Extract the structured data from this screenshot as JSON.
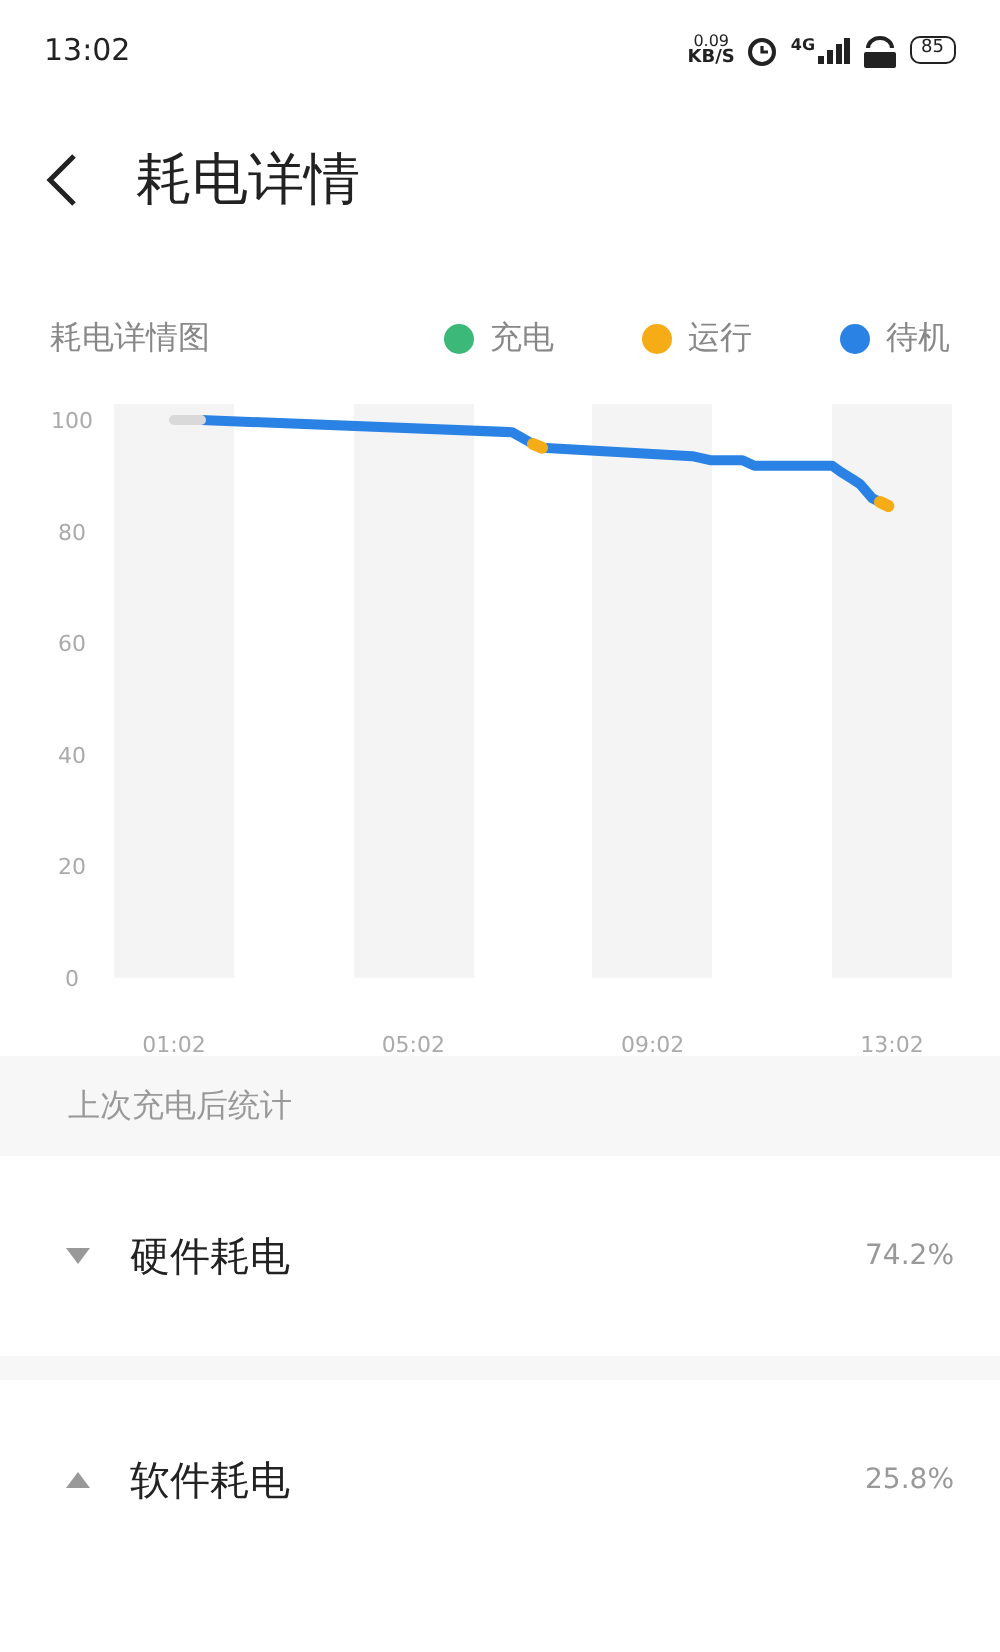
{
  "status_bar": {
    "time": "13:02",
    "net_speed": "0.09",
    "net_unit": "KB/S",
    "network": "4G",
    "battery": "85"
  },
  "header": {
    "title": "耗电详情"
  },
  "chart_section": {
    "title": "耗电详情图",
    "chart_data": {
      "type": "line",
      "x": [
        1.033,
        1.483,
        6.683,
        7.033,
        7.183,
        9.693,
        9.993,
        10.533,
        10.733,
        12.033,
        12.173,
        12.373,
        12.503,
        12.703,
        12.833,
        12.973
      ],
      "series": [
        {
          "color": "#d9d9d9",
          "values": [
            100,
            100,
            null,
            null,
            null,
            null,
            null,
            null,
            null,
            null,
            null,
            null,
            null,
            null,
            null,
            null
          ]
        },
        {
          "name": "充电",
          "color": "#3cb878",
          "values": [
            null,
            null,
            null,
            null,
            null,
            null,
            null,
            null,
            null,
            null,
            null,
            null,
            null,
            null,
            null,
            null
          ]
        },
        {
          "name": "运行",
          "color": "#f5ac16",
          "values": [
            null,
            null,
            null,
            95.7,
            95,
            null,
            null,
            null,
            null,
            null,
            null,
            null,
            null,
            null,
            85.3,
            84.6
          ]
        },
        {
          "name": "待机",
          "color": "#2a82e4",
          "values": [
            null,
            100,
            97.8,
            95.7,
            95,
            93.5,
            92.8,
            92.8,
            91.8,
            91.8,
            90.7,
            89.4,
            88.5,
            86,
            85.3,
            null
          ]
        }
      ],
      "xlim": [
        1.033,
        13.033
      ],
      "ylim": [
        0,
        100
      ],
      "xticks": [
        {
          "value": 1.033,
          "label": "01:02"
        },
        {
          "value": 5.033,
          "label": "05:02"
        },
        {
          "value": 9.033,
          "label": "09:02"
        },
        {
          "value": 13.033,
          "label": "13:02"
        }
      ],
      "yticks": [
        0,
        20,
        40,
        60,
        80,
        100
      ]
    }
  },
  "stats_header": "上次充电后统计",
  "stats": [
    {
      "label": "硬件耗电",
      "value": "74.2%",
      "expanded": false
    },
    {
      "label": "软件耗电",
      "value": "25.8%",
      "expanded": true
    }
  ]
}
